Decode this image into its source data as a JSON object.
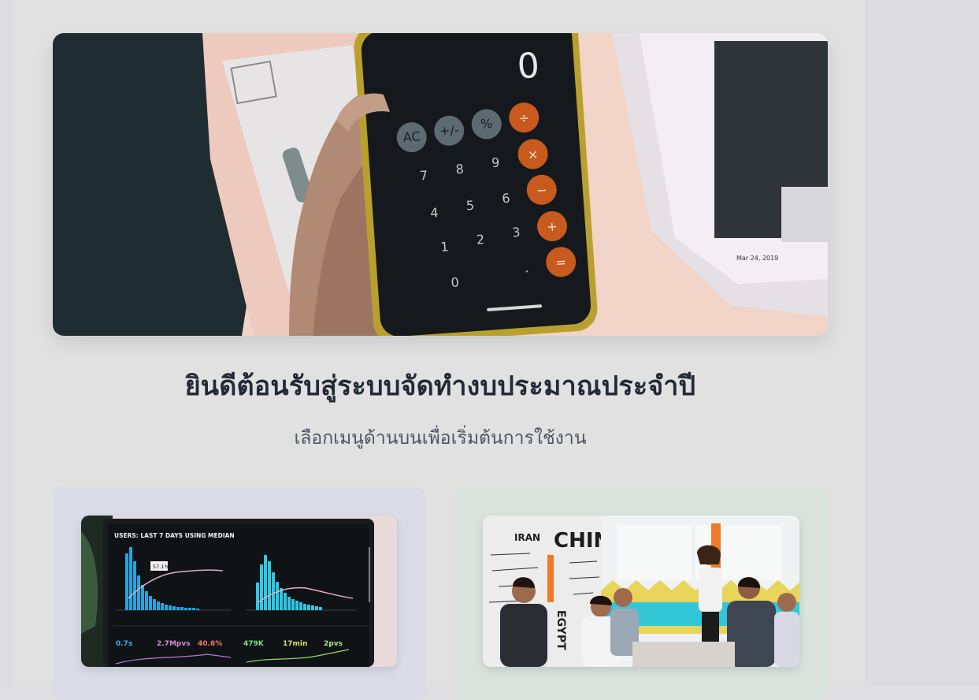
{
  "hero": {
    "image_icon": "calculator-photo",
    "calc": {
      "display": "0",
      "keys": [
        "AC",
        "+/-",
        "%",
        "÷",
        "7",
        "8",
        "9",
        "×",
        "4",
        "5",
        "6",
        "−",
        "1",
        "2",
        "3",
        "+",
        "0",
        ".",
        "="
      ]
    },
    "paper_date": "Mar 24, 2019"
  },
  "welcome": {
    "title": "ยินดีต้อนรับสู่ระบบจัดทำงบประมาณประจำปี",
    "subtitle": "เลือกเมนูด้านบนเพื่อเริ่มต้นการใช้งาน"
  },
  "cards": [
    {
      "theme": "blue",
      "image_icon": "analytics-dashboard-photo",
      "screen": {
        "header": "USERS: LAST 7 DAYS USING MEDIAN",
        "tooltip": "57.1%",
        "stats_left": [
          "0.7s",
          "2.7Mpvs",
          "40.6%"
        ],
        "stats_right": [
          "479K",
          "17min",
          "2pvs"
        ]
      }
    },
    {
      "theme": "green",
      "image_icon": "business-meeting-photo",
      "wall_words": [
        "CHINA",
        "IRAN",
        "EGYPT"
      ]
    }
  ],
  "colors": {
    "background": "#dfdfe1",
    "title": "#222a36",
    "subtitle": "#4e5562",
    "card_blue": "#d9dce6",
    "card_green": "#d9e3dc",
    "calc_orange": "#c85a1e"
  }
}
